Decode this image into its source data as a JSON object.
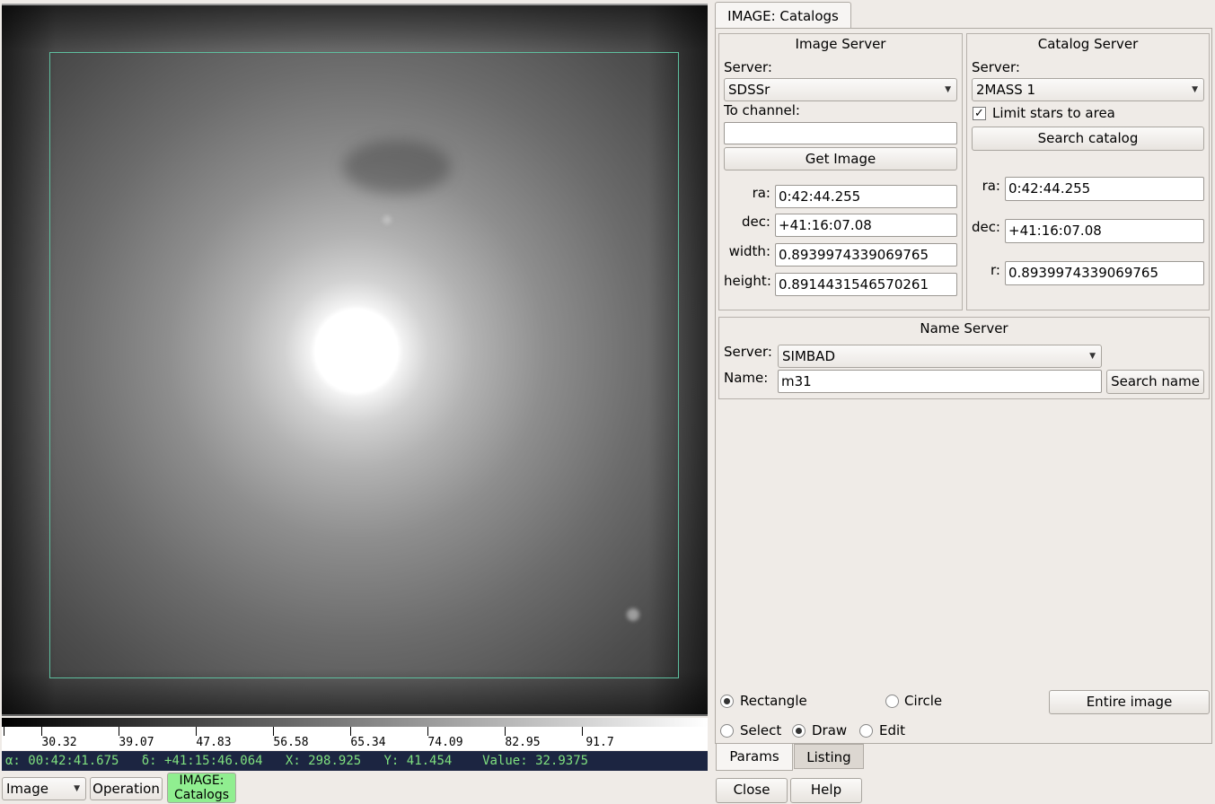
{
  "viewer": {
    "colorbar_ticks": [
      "30.32",
      "39.07",
      "47.83",
      "56.58",
      "65.34",
      "74.09",
      "82.95",
      "91.7"
    ],
    "readout": {
      "ra": "α: 00:42:41.675",
      "dec": "δ: +41:15:46.064",
      "x": "X: 298.925",
      "y": "Y: 41.454",
      "value": "Value: 32.9375"
    }
  },
  "toolbar": {
    "image_combo": "Image",
    "operation_button": "Operation",
    "plugin_button_line1": "IMAGE:",
    "plugin_button_line2": "Catalogs",
    "plugin_button_color": "#90ee90"
  },
  "panel": {
    "tab_title": "IMAGE: Catalogs",
    "image_server": {
      "title": "Image Server",
      "server_label": "Server:",
      "server_value": "SDSSr",
      "channel_label": "To channel:",
      "channel_value": "",
      "get_image_label": "Get Image",
      "ra_label": "ra:",
      "ra_value": "0:42:44.255",
      "dec_label": "dec:",
      "dec_value": "+41:16:07.08",
      "width_label": "width:",
      "width_value": "0.8939974339069765",
      "height_label": "height:",
      "height_value": "0.8914431546570261"
    },
    "catalog_server": {
      "title": "Catalog Server",
      "server_label": "Server:",
      "server_value": "2MASS 1",
      "limit_label": "Limit stars to area",
      "limit_checked": "✓",
      "search_label": "Search catalog",
      "ra_label": "ra:",
      "ra_value": "0:42:44.255",
      "dec_label": "dec:",
      "dec_value": "+41:16:07.08",
      "r_label": "r:",
      "r_value": "0.8939974339069765"
    },
    "name_server": {
      "title": "Name Server",
      "server_label": "Server:",
      "server_value": "SIMBAD",
      "name_label": "Name:",
      "name_value": "m31",
      "search_label": "Search name"
    },
    "shape": {
      "rectangle_label": "Rectangle",
      "circle_label": "Circle",
      "entire_image_label": "Entire image",
      "selected": "rectangle"
    },
    "mode": {
      "select_label": "Select",
      "draw_label": "Draw",
      "edit_label": "Edit",
      "selected": "draw"
    },
    "bottom_tabs": [
      "Params",
      "Listing"
    ],
    "close_label": "Close",
    "help_label": "Help"
  }
}
